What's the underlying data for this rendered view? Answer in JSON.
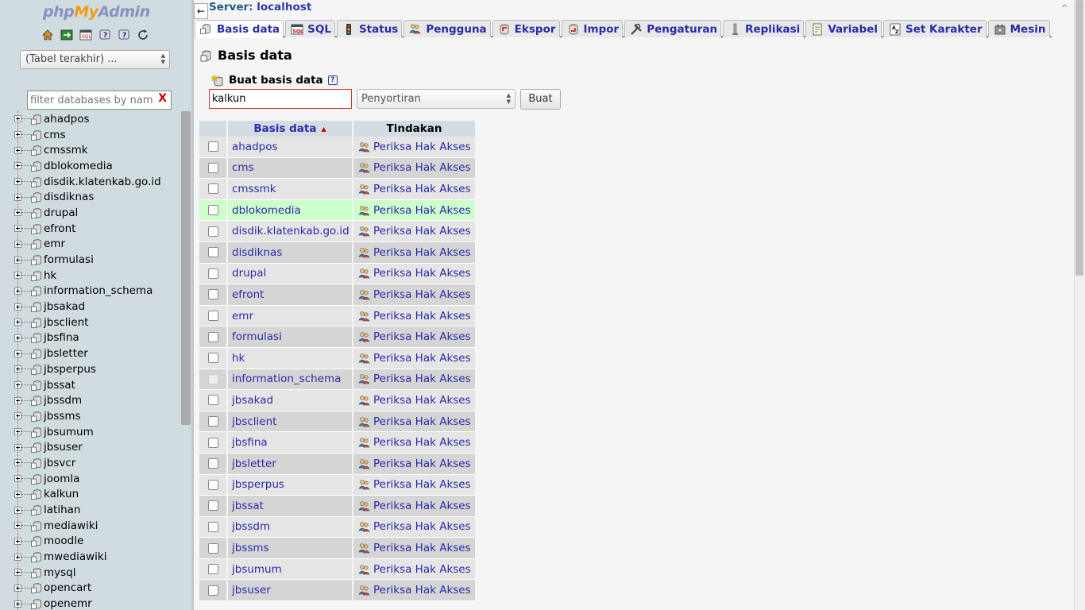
{
  "nav": {
    "logo": {
      "php": "php",
      "my": "My",
      "admin": "Admin"
    },
    "icons": [
      "home-icon",
      "logout-icon",
      "sql-query-icon",
      "docs-icon",
      "wiki-icon",
      "reload-icon"
    ],
    "recent_select": "(Tabel terakhir) ...",
    "filter_placeholder": "filter databases by name",
    "filter_clear": "X",
    "databases": [
      "ahadpos",
      "cms",
      "cmssmk",
      "dblokomedia",
      "disdik.klatenkab.go.id",
      "disdiknas",
      "drupal",
      "efront",
      "emr",
      "formulasi",
      "hk",
      "information_schema",
      "jbsakad",
      "jbsclient",
      "jbsfina",
      "jbsletter",
      "jbsperpus",
      "jbssat",
      "jbssdm",
      "jbssms",
      "jbsumum",
      "jbsuser",
      "jbsvcr",
      "joomla",
      "kalkun",
      "latihan",
      "mediawiki",
      "moodle",
      "mwediawiki",
      "mysql",
      "opencart",
      "openemr"
    ]
  },
  "header": {
    "collapse_arrow": "←",
    "server_prefix": "Server: ",
    "server_name": "localhost",
    "close_glyph": "⌃"
  },
  "tabs": [
    {
      "label": "Basis data",
      "icon": "database-icon",
      "active": true
    },
    {
      "label": "SQL",
      "icon": "sql-icon"
    },
    {
      "label": "Status",
      "icon": "traffic-light-icon"
    },
    {
      "label": "Pengguna",
      "icon": "users-icon"
    },
    {
      "label": "Ekspor",
      "icon": "export-icon"
    },
    {
      "label": "Impor",
      "icon": "import-icon"
    },
    {
      "label": "Pengaturan",
      "icon": "wrench-icon"
    },
    {
      "label": "Replikasi",
      "icon": "replication-icon"
    },
    {
      "label": "Variabel",
      "icon": "variables-icon"
    },
    {
      "label": "Set Karakter",
      "icon": "charset-icon"
    },
    {
      "label": "Mesin",
      "icon": "engine-icon"
    }
  ],
  "main": {
    "title": "Basis data",
    "create_label": "Buat basis data",
    "help_glyph": "?",
    "dbname_value": "kalkun",
    "collation_placeholder": "Penyortiran",
    "create_button": "Buat",
    "table": {
      "col_db": "Basis data",
      "col_action": "Tindakan",
      "action_label": "Periksa Hak Akses",
      "rows": [
        "ahadpos",
        "cms",
        "cmssmk",
        "dblokomedia",
        "disdik.klatenkab.go.id",
        "disdiknas",
        "drupal",
        "efront",
        "emr",
        "formulasi",
        "hk",
        "information_schema",
        "jbsakad",
        "jbsclient",
        "jbsfina",
        "jbsletter",
        "jbsperpus",
        "jbssat",
        "jbssdm",
        "jbssms",
        "jbsumum",
        "jbsuser"
      ],
      "highlighted_row": "dblokomedia",
      "disabled_row": "information_schema"
    }
  },
  "colors": {
    "link": "#2a2aaa",
    "nav_bg": "#d0dce0",
    "header_bg": "#d3dce3",
    "highlight": "#ccffcc",
    "error_border": "#cc3333"
  }
}
